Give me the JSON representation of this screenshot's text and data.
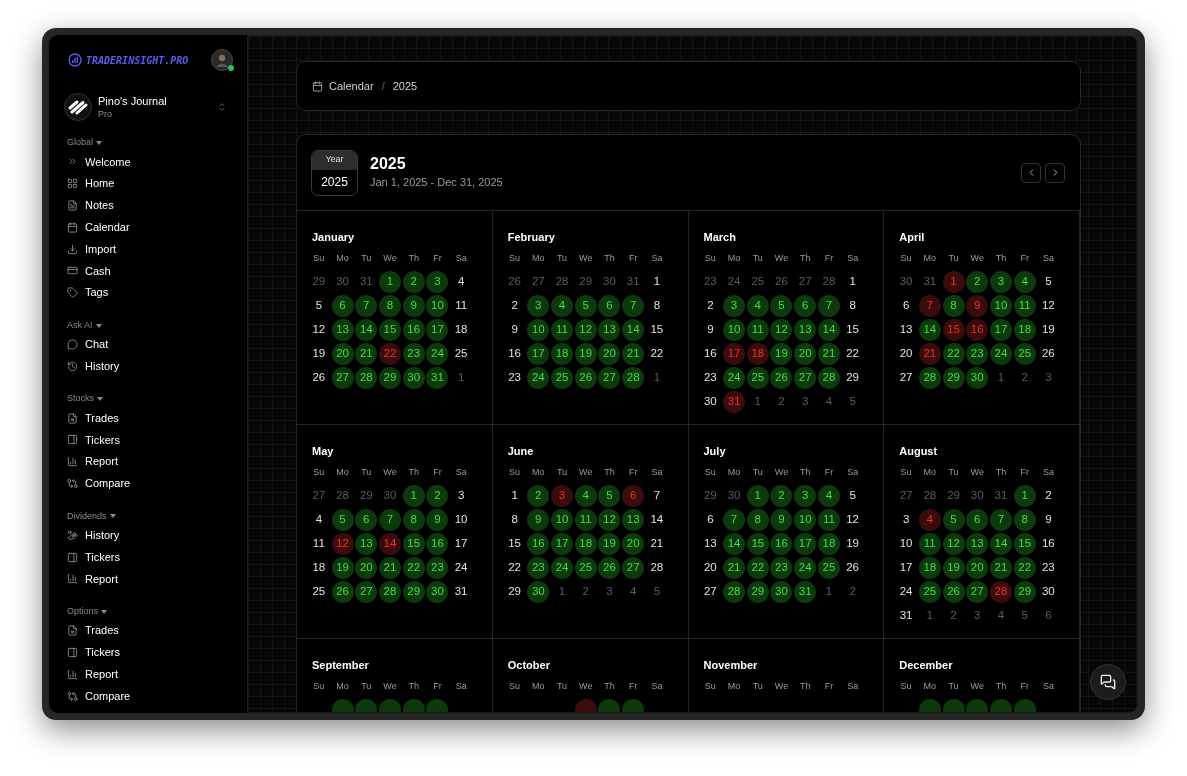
{
  "brand": {
    "name": "TRADERINSIGHT.PRO"
  },
  "user": {
    "online": true
  },
  "journal": {
    "name": "Pino's Journal",
    "plan": "Pro"
  },
  "sidebar": {
    "sections": [
      {
        "title": "Global",
        "items": [
          {
            "label": "Welcome",
            "kind": "welcome"
          },
          {
            "label": "Home",
            "kind": "home"
          },
          {
            "label": "Notes",
            "kind": "notes"
          },
          {
            "label": "Calendar",
            "kind": "calendar"
          },
          {
            "label": "Import",
            "kind": "import"
          },
          {
            "label": "Cash",
            "kind": "cash"
          },
          {
            "label": "Tags",
            "kind": "tags"
          }
        ]
      },
      {
        "title": "Ask AI",
        "items": [
          {
            "label": "Chat",
            "kind": "chat"
          },
          {
            "label": "History",
            "kind": "history"
          }
        ]
      },
      {
        "title": "Stocks",
        "items": [
          {
            "label": "Trades",
            "kind": "trades"
          },
          {
            "label": "Tickers",
            "kind": "tickers"
          },
          {
            "label": "Report",
            "kind": "report"
          },
          {
            "label": "Compare",
            "kind": "compare"
          }
        ]
      },
      {
        "title": "Dividends",
        "items": [
          {
            "label": "History",
            "kind": "dividends"
          },
          {
            "label": "Tickers",
            "kind": "tickers"
          },
          {
            "label": "Report",
            "kind": "report"
          }
        ]
      },
      {
        "title": "Options",
        "items": [
          {
            "label": "Trades",
            "kind": "trades"
          },
          {
            "label": "Tickers",
            "kind": "tickers"
          },
          {
            "label": "Report",
            "kind": "report"
          },
          {
            "label": "Compare",
            "kind": "compare"
          }
        ]
      }
    ]
  },
  "breadcrumb": {
    "items": [
      "Calendar",
      "2025"
    ],
    "separator": "/"
  },
  "calendar": {
    "badge_label": "Year",
    "badge_value": "2025",
    "title": "2025",
    "range": "Jan 1, 2025 - Dec 31, 2025",
    "months": [
      {
        "name": "January",
        "weekdays": [
          "Su",
          "Mo",
          "Tu",
          "We",
          "Th",
          "Fr",
          "Sa"
        ],
        "days": [
          {
            "day": "29",
            "kind": "out"
          },
          {
            "day": "30",
            "kind": "out"
          },
          {
            "day": "31",
            "kind": "out"
          },
          {
            "day": "1",
            "kind": "win"
          },
          {
            "day": "2",
            "kind": "win"
          },
          {
            "day": "3",
            "kind": "win"
          },
          {
            "day": "4",
            "kind": "plain"
          },
          {
            "day": "5",
            "kind": "plain"
          },
          {
            "day": "6",
            "kind": "win"
          },
          {
            "day": "7",
            "kind": "win"
          },
          {
            "day": "8",
            "kind": "win"
          },
          {
            "day": "9",
            "kind": "win"
          },
          {
            "day": "10",
            "kind": "win"
          },
          {
            "day": "11",
            "kind": "plain"
          },
          {
            "day": "12",
            "kind": "plain"
          },
          {
            "day": "13",
            "kind": "win"
          },
          {
            "day": "14",
            "kind": "win"
          },
          {
            "day": "15",
            "kind": "win"
          },
          {
            "day": "16",
            "kind": "win"
          },
          {
            "day": "17",
            "kind": "win"
          },
          {
            "day": "18",
            "kind": "plain"
          },
          {
            "day": "19",
            "kind": "plain"
          },
          {
            "day": "20",
            "kind": "win"
          },
          {
            "day": "21",
            "kind": "win"
          },
          {
            "day": "22",
            "kind": "loss"
          },
          {
            "day": "23",
            "kind": "win"
          },
          {
            "day": "24",
            "kind": "win"
          },
          {
            "day": "25",
            "kind": "plain"
          },
          {
            "day": "26",
            "kind": "plain"
          },
          {
            "day": "27",
            "kind": "win"
          },
          {
            "day": "28",
            "kind": "win"
          },
          {
            "day": "29",
            "kind": "win"
          },
          {
            "day": "30",
            "kind": "win"
          },
          {
            "day": "31",
            "kind": "win"
          },
          {
            "day": "1",
            "kind": "out"
          }
        ]
      },
      {
        "name": "February",
        "weekdays": [
          "Su",
          "Mo",
          "Tu",
          "We",
          "Th",
          "Fr",
          "Sa"
        ],
        "days": [
          {
            "day": "26",
            "kind": "out"
          },
          {
            "day": "27",
            "kind": "out"
          },
          {
            "day": "28",
            "kind": "out"
          },
          {
            "day": "29",
            "kind": "out"
          },
          {
            "day": "30",
            "kind": "out"
          },
          {
            "day": "31",
            "kind": "out"
          },
          {
            "day": "1",
            "kind": "plain"
          },
          {
            "day": "2",
            "kind": "plain"
          },
          {
            "day": "3",
            "kind": "win"
          },
          {
            "day": "4",
            "kind": "win"
          },
          {
            "day": "5",
            "kind": "win"
          },
          {
            "day": "6",
            "kind": "win"
          },
          {
            "day": "7",
            "kind": "win"
          },
          {
            "day": "8",
            "kind": "plain"
          },
          {
            "day": "9",
            "kind": "plain"
          },
          {
            "day": "10",
            "kind": "win"
          },
          {
            "day": "11",
            "kind": "win"
          },
          {
            "day": "12",
            "kind": "win"
          },
          {
            "day": "13",
            "kind": "win"
          },
          {
            "day": "14",
            "kind": "win"
          },
          {
            "day": "15",
            "kind": "plain"
          },
          {
            "day": "16",
            "kind": "plain"
          },
          {
            "day": "17",
            "kind": "win"
          },
          {
            "day": "18",
            "kind": "win"
          },
          {
            "day": "19",
            "kind": "win"
          },
          {
            "day": "20",
            "kind": "win"
          },
          {
            "day": "21",
            "kind": "win"
          },
          {
            "day": "22",
            "kind": "plain"
          },
          {
            "day": "23",
            "kind": "plain"
          },
          {
            "day": "24",
            "kind": "win"
          },
          {
            "day": "25",
            "kind": "win"
          },
          {
            "day": "26",
            "kind": "win"
          },
          {
            "day": "27",
            "kind": "win"
          },
          {
            "day": "28",
            "kind": "win"
          },
          {
            "day": "1",
            "kind": "out"
          }
        ]
      },
      {
        "name": "March",
        "weekdays": [
          "Su",
          "Mo",
          "Tu",
          "We",
          "Th",
          "Fr",
          "Sa"
        ],
        "days": [
          {
            "day": "23",
            "kind": "out"
          },
          {
            "day": "24",
            "kind": "out"
          },
          {
            "day": "25",
            "kind": "out"
          },
          {
            "day": "26",
            "kind": "out"
          },
          {
            "day": "27",
            "kind": "out"
          },
          {
            "day": "28",
            "kind": "out"
          },
          {
            "day": "1",
            "kind": "plain"
          },
          {
            "day": "2",
            "kind": "plain"
          },
          {
            "day": "3",
            "kind": "win"
          },
          {
            "day": "4",
            "kind": "win"
          },
          {
            "day": "5",
            "kind": "win"
          },
          {
            "day": "6",
            "kind": "win"
          },
          {
            "day": "7",
            "kind": "win"
          },
          {
            "day": "8",
            "kind": "plain"
          },
          {
            "day": "9",
            "kind": "plain"
          },
          {
            "day": "10",
            "kind": "win"
          },
          {
            "day": "11",
            "kind": "win"
          },
          {
            "day": "12",
            "kind": "win"
          },
          {
            "day": "13",
            "kind": "win"
          },
          {
            "day": "14",
            "kind": "win"
          },
          {
            "day": "15",
            "kind": "plain"
          },
          {
            "day": "16",
            "kind": "plain"
          },
          {
            "day": "17",
            "kind": "loss"
          },
          {
            "day": "18",
            "kind": "loss"
          },
          {
            "day": "19",
            "kind": "win"
          },
          {
            "day": "20",
            "kind": "win"
          },
          {
            "day": "21",
            "kind": "win"
          },
          {
            "day": "22",
            "kind": "plain"
          },
          {
            "day": "23",
            "kind": "plain"
          },
          {
            "day": "24",
            "kind": "win"
          },
          {
            "day": "25",
            "kind": "win"
          },
          {
            "day": "26",
            "kind": "win"
          },
          {
            "day": "27",
            "kind": "win"
          },
          {
            "day": "28",
            "kind": "win"
          },
          {
            "day": "29",
            "kind": "plain"
          },
          {
            "day": "30",
            "kind": "plain"
          },
          {
            "day": "31",
            "kind": "loss"
          },
          {
            "day": "1",
            "kind": "out"
          },
          {
            "day": "2",
            "kind": "out"
          },
          {
            "day": "3",
            "kind": "out"
          },
          {
            "day": "4",
            "kind": "out"
          },
          {
            "day": "5",
            "kind": "out"
          }
        ]
      },
      {
        "name": "April",
        "weekdays": [
          "Su",
          "Mo",
          "Tu",
          "We",
          "Th",
          "Fr",
          "Sa"
        ],
        "days": [
          {
            "day": "30",
            "kind": "out"
          },
          {
            "day": "31",
            "kind": "out"
          },
          {
            "day": "1",
            "kind": "loss"
          },
          {
            "day": "2",
            "kind": "win"
          },
          {
            "day": "3",
            "kind": "win"
          },
          {
            "day": "4",
            "kind": "win"
          },
          {
            "day": "5",
            "kind": "plain"
          },
          {
            "day": "6",
            "kind": "plain"
          },
          {
            "day": "7",
            "kind": "loss"
          },
          {
            "day": "8",
            "kind": "win"
          },
          {
            "day": "9",
            "kind": "loss"
          },
          {
            "day": "10",
            "kind": "win"
          },
          {
            "day": "11",
            "kind": "win"
          },
          {
            "day": "12",
            "kind": "plain"
          },
          {
            "day": "13",
            "kind": "plain"
          },
          {
            "day": "14",
            "kind": "win"
          },
          {
            "day": "15",
            "kind": "loss"
          },
          {
            "day": "16",
            "kind": "loss"
          },
          {
            "day": "17",
            "kind": "win"
          },
          {
            "day": "18",
            "kind": "win"
          },
          {
            "day": "19",
            "kind": "plain"
          },
          {
            "day": "20",
            "kind": "plain"
          },
          {
            "day": "21",
            "kind": "loss"
          },
          {
            "day": "22",
            "kind": "win"
          },
          {
            "day": "23",
            "kind": "win"
          },
          {
            "day": "24",
            "kind": "win"
          },
          {
            "day": "25",
            "kind": "win"
          },
          {
            "day": "26",
            "kind": "plain"
          },
          {
            "day": "27",
            "kind": "plain"
          },
          {
            "day": "28",
            "kind": "win"
          },
          {
            "day": "29",
            "kind": "win"
          },
          {
            "day": "30",
            "kind": "win"
          },
          {
            "day": "1",
            "kind": "out"
          },
          {
            "day": "2",
            "kind": "out"
          },
          {
            "day": "3",
            "kind": "out"
          }
        ]
      },
      {
        "name": "May",
        "weekdays": [
          "Su",
          "Mo",
          "Tu",
          "We",
          "Th",
          "Fr",
          "Sa"
        ],
        "days": [
          {
            "day": "27",
            "kind": "out"
          },
          {
            "day": "28",
            "kind": "out"
          },
          {
            "day": "29",
            "kind": "out"
          },
          {
            "day": "30",
            "kind": "out"
          },
          {
            "day": "1",
            "kind": "win"
          },
          {
            "day": "2",
            "kind": "win"
          },
          {
            "day": "3",
            "kind": "plain"
          },
          {
            "day": "4",
            "kind": "plain"
          },
          {
            "day": "5",
            "kind": "win"
          },
          {
            "day": "6",
            "kind": "win"
          },
          {
            "day": "7",
            "kind": "win"
          },
          {
            "day": "8",
            "kind": "win"
          },
          {
            "day": "9",
            "kind": "win"
          },
          {
            "day": "10",
            "kind": "plain"
          },
          {
            "day": "11",
            "kind": "plain"
          },
          {
            "day": "12",
            "kind": "loss"
          },
          {
            "day": "13",
            "kind": "win"
          },
          {
            "day": "14",
            "kind": "loss"
          },
          {
            "day": "15",
            "kind": "win"
          },
          {
            "day": "16",
            "kind": "win"
          },
          {
            "day": "17",
            "kind": "plain"
          },
          {
            "day": "18",
            "kind": "plain"
          },
          {
            "day": "19",
            "kind": "win"
          },
          {
            "day": "20",
            "kind": "win"
          },
          {
            "day": "21",
            "kind": "win"
          },
          {
            "day": "22",
            "kind": "win"
          },
          {
            "day": "23",
            "kind": "win"
          },
          {
            "day": "24",
            "kind": "plain"
          },
          {
            "day": "25",
            "kind": "plain"
          },
          {
            "day": "26",
            "kind": "win"
          },
          {
            "day": "27",
            "kind": "win"
          },
          {
            "day": "28",
            "kind": "win"
          },
          {
            "day": "29",
            "kind": "win"
          },
          {
            "day": "30",
            "kind": "win"
          },
          {
            "day": "31",
            "kind": "plain"
          }
        ]
      },
      {
        "name": "June",
        "weekdays": [
          "Su",
          "Mo",
          "Tu",
          "We",
          "Th",
          "Fr",
          "Sa"
        ],
        "days": [
          {
            "day": "1",
            "kind": "plain"
          },
          {
            "day": "2",
            "kind": "win"
          },
          {
            "day": "3",
            "kind": "loss"
          },
          {
            "day": "4",
            "kind": "win"
          },
          {
            "day": "5",
            "kind": "win"
          },
          {
            "day": "6",
            "kind": "loss"
          },
          {
            "day": "7",
            "kind": "plain"
          },
          {
            "day": "8",
            "kind": "plain"
          },
          {
            "day": "9",
            "kind": "win"
          },
          {
            "day": "10",
            "kind": "win"
          },
          {
            "day": "11",
            "kind": "win"
          },
          {
            "day": "12",
            "kind": "win"
          },
          {
            "day": "13",
            "kind": "win"
          },
          {
            "day": "14",
            "kind": "plain"
          },
          {
            "day": "15",
            "kind": "plain"
          },
          {
            "day": "16",
            "kind": "win"
          },
          {
            "day": "17",
            "kind": "win"
          },
          {
            "day": "18",
            "kind": "win"
          },
          {
            "day": "19",
            "kind": "win"
          },
          {
            "day": "20",
            "kind": "win"
          },
          {
            "day": "21",
            "kind": "plain"
          },
          {
            "day": "22",
            "kind": "plain"
          },
          {
            "day": "23",
            "kind": "win"
          },
          {
            "day": "24",
            "kind": "win"
          },
          {
            "day": "25",
            "kind": "win"
          },
          {
            "day": "26",
            "kind": "win"
          },
          {
            "day": "27",
            "kind": "win"
          },
          {
            "day": "28",
            "kind": "plain"
          },
          {
            "day": "29",
            "kind": "plain"
          },
          {
            "day": "30",
            "kind": "win"
          },
          {
            "day": "1",
            "kind": "out"
          },
          {
            "day": "2",
            "kind": "out"
          },
          {
            "day": "3",
            "kind": "out"
          },
          {
            "day": "4",
            "kind": "out"
          },
          {
            "day": "5",
            "kind": "out"
          }
        ]
      },
      {
        "name": "July",
        "weekdays": [
          "Su",
          "Mo",
          "Tu",
          "We",
          "Th",
          "Fr",
          "Sa"
        ],
        "days": [
          {
            "day": "29",
            "kind": "out"
          },
          {
            "day": "30",
            "kind": "out"
          },
          {
            "day": "1",
            "kind": "win"
          },
          {
            "day": "2",
            "kind": "win"
          },
          {
            "day": "3",
            "kind": "win"
          },
          {
            "day": "4",
            "kind": "win"
          },
          {
            "day": "5",
            "kind": "plain"
          },
          {
            "day": "6",
            "kind": "plain"
          },
          {
            "day": "7",
            "kind": "win"
          },
          {
            "day": "8",
            "kind": "win"
          },
          {
            "day": "9",
            "kind": "win"
          },
          {
            "day": "10",
            "kind": "win"
          },
          {
            "day": "11",
            "kind": "win"
          },
          {
            "day": "12",
            "kind": "plain"
          },
          {
            "day": "13",
            "kind": "plain"
          },
          {
            "day": "14",
            "kind": "win"
          },
          {
            "day": "15",
            "kind": "win"
          },
          {
            "day": "16",
            "kind": "win"
          },
          {
            "day": "17",
            "kind": "win"
          },
          {
            "day": "18",
            "kind": "win"
          },
          {
            "day": "19",
            "kind": "plain"
          },
          {
            "day": "20",
            "kind": "plain"
          },
          {
            "day": "21",
            "kind": "win"
          },
          {
            "day": "22",
            "kind": "win"
          },
          {
            "day": "23",
            "kind": "win"
          },
          {
            "day": "24",
            "kind": "win"
          },
          {
            "day": "25",
            "kind": "win"
          },
          {
            "day": "26",
            "kind": "plain"
          },
          {
            "day": "27",
            "kind": "plain"
          },
          {
            "day": "28",
            "kind": "win"
          },
          {
            "day": "29",
            "kind": "win"
          },
          {
            "day": "30",
            "kind": "win"
          },
          {
            "day": "31",
            "kind": "win"
          },
          {
            "day": "1",
            "kind": "out"
          },
          {
            "day": "2",
            "kind": "out"
          }
        ]
      },
      {
        "name": "August",
        "weekdays": [
          "Su",
          "Mo",
          "Tu",
          "We",
          "Th",
          "Fr",
          "Sa"
        ],
        "days": [
          {
            "day": "27",
            "kind": "out"
          },
          {
            "day": "28",
            "kind": "out"
          },
          {
            "day": "29",
            "kind": "out"
          },
          {
            "day": "30",
            "kind": "out"
          },
          {
            "day": "31",
            "kind": "out"
          },
          {
            "day": "1",
            "kind": "win"
          },
          {
            "day": "2",
            "kind": "plain"
          },
          {
            "day": "3",
            "kind": "plain"
          },
          {
            "day": "4",
            "kind": "loss"
          },
          {
            "day": "5",
            "kind": "win"
          },
          {
            "day": "6",
            "kind": "win"
          },
          {
            "day": "7",
            "kind": "win"
          },
          {
            "day": "8",
            "kind": "win"
          },
          {
            "day": "9",
            "kind": "plain"
          },
          {
            "day": "10",
            "kind": "plain"
          },
          {
            "day": "11",
            "kind": "win"
          },
          {
            "day": "12",
            "kind": "win"
          },
          {
            "day": "13",
            "kind": "win"
          },
          {
            "day": "14",
            "kind": "win"
          },
          {
            "day": "15",
            "kind": "win"
          },
          {
            "day": "16",
            "kind": "plain"
          },
          {
            "day": "17",
            "kind": "plain"
          },
          {
            "day": "18",
            "kind": "win"
          },
          {
            "day": "19",
            "kind": "win"
          },
          {
            "day": "20",
            "kind": "win"
          },
          {
            "day": "21",
            "kind": "win"
          },
          {
            "day": "22",
            "kind": "win"
          },
          {
            "day": "23",
            "kind": "plain"
          },
          {
            "day": "24",
            "kind": "plain"
          },
          {
            "day": "25",
            "kind": "win"
          },
          {
            "day": "26",
            "kind": "win"
          },
          {
            "day": "27",
            "kind": "win"
          },
          {
            "day": "28",
            "kind": "loss"
          },
          {
            "day": "29",
            "kind": "win"
          },
          {
            "day": "30",
            "kind": "plain"
          },
          {
            "day": "31",
            "kind": "plain"
          },
          {
            "day": "1",
            "kind": "out"
          },
          {
            "day": "2",
            "kind": "out"
          },
          {
            "day": "3",
            "kind": "out"
          },
          {
            "day": "4",
            "kind": "out"
          },
          {
            "day": "5",
            "kind": "out"
          },
          {
            "day": "6",
            "kind": "out"
          }
        ]
      },
      {
        "name": "September",
        "weekdays": [
          "Su",
          "Mo",
          "Tu",
          "We",
          "Th",
          "Fr",
          "Sa"
        ],
        "peek": [
          {
            "kind": "out"
          },
          {
            "kind": "win"
          },
          {
            "kind": "win"
          },
          {
            "kind": "win"
          },
          {
            "kind": "win"
          },
          {
            "kind": "win"
          },
          {
            "kind": "plain"
          }
        ]
      },
      {
        "name": "October",
        "weekdays": [
          "Su",
          "Mo",
          "Tu",
          "We",
          "Th",
          "Fr",
          "Sa"
        ],
        "peek": [
          {
            "kind": "out"
          },
          {
            "kind": "out"
          },
          {
            "kind": "out"
          },
          {
            "kind": "loss"
          },
          {
            "kind": "win"
          },
          {
            "kind": "win"
          },
          {
            "kind": "plain"
          }
        ]
      },
      {
        "name": "November",
        "weekdays": [
          "Su",
          "Mo",
          "Tu",
          "We",
          "Th",
          "Fr",
          "Sa"
        ],
        "peek": [
          {
            "kind": "out"
          },
          {
            "kind": "out"
          },
          {
            "kind": "out"
          },
          {
            "kind": "out"
          },
          {
            "kind": "out"
          },
          {
            "kind": "out"
          },
          {
            "kind": "plain"
          }
        ]
      },
      {
        "name": "December",
        "weekdays": [
          "Su",
          "Mo",
          "Tu",
          "We",
          "Th",
          "Fr",
          "Sa"
        ],
        "peek": [
          {
            "kind": "out"
          },
          {
            "kind": "win"
          },
          {
            "kind": "win"
          },
          {
            "kind": "win"
          },
          {
            "kind": "win"
          },
          {
            "kind": "win"
          },
          {
            "kind": "plain"
          }
        ]
      }
    ]
  }
}
